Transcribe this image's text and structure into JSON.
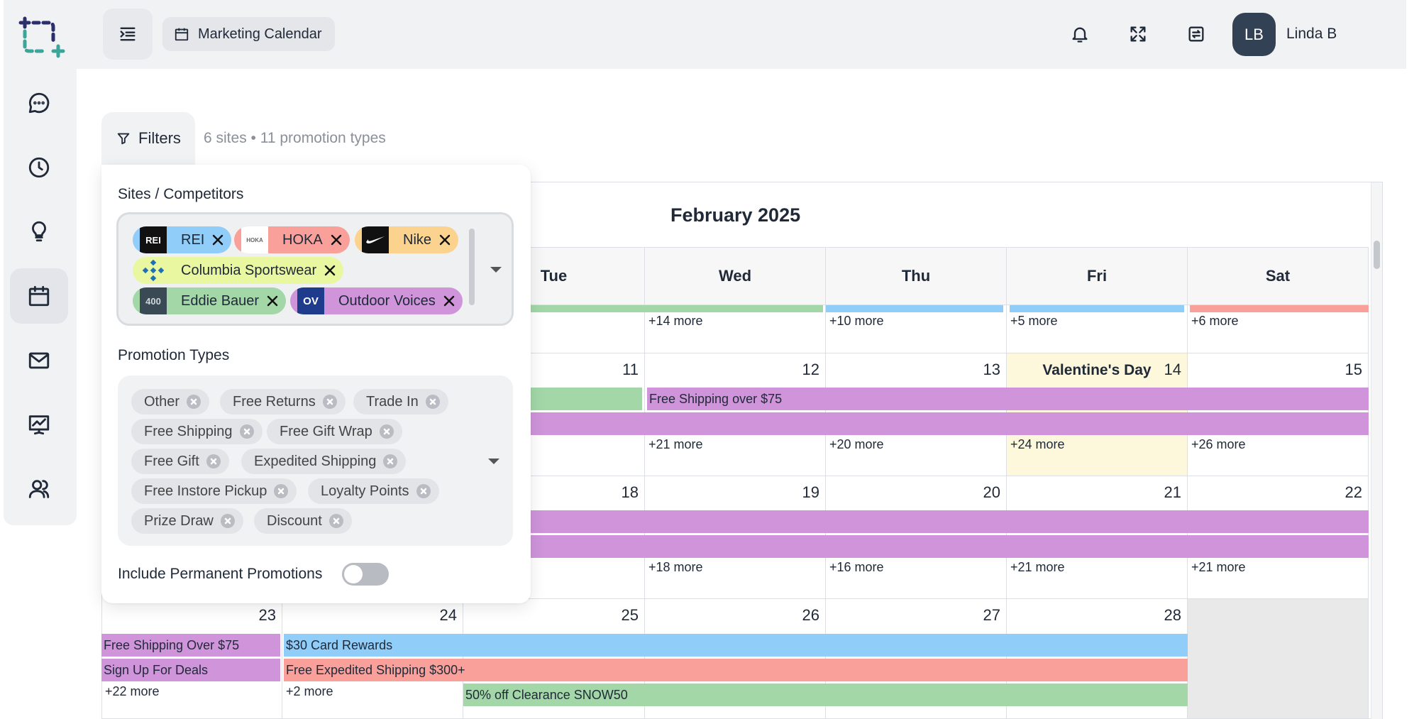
{
  "app": {
    "title": "Marketing Calendar"
  },
  "user": {
    "initials": "LB",
    "name": "Linda B"
  },
  "sidebar": {
    "icons": [
      "chat-icon",
      "clock-icon",
      "lightbulb-icon",
      "calendar-icon",
      "mail-icon",
      "presentation-chart-icon",
      "users-icon"
    ],
    "active": "calendar-icon"
  },
  "topbar": {
    "icons": [
      "bell-icon",
      "fullscreen-icon",
      "refresh-calendar-icon"
    ]
  },
  "filters": {
    "button_label": "Filters",
    "summary": "6 sites • 11 promotion types",
    "sites_label": "Sites / Competitors",
    "sites": [
      {
        "name": "REI",
        "color": "#90cdf9"
      },
      {
        "name": "HOKA",
        "color": "#f9a09b"
      },
      {
        "name": "Nike",
        "color": "#fbd28e"
      },
      {
        "name": "Columbia Sportswear",
        "color": "#e9f7a0"
      },
      {
        "name": "Eddie Bauer",
        "color": "#a3d7a8"
      },
      {
        "name": "Outdoor Voices",
        "color": "#cf94da"
      }
    ],
    "logos": {
      "rei": "REI",
      "hoka": "HOKA",
      "eddie": "400",
      "ov": "OV"
    },
    "promo_label": "Promotion Types",
    "promo_types": [
      "Other",
      "Free Returns",
      "Trade In",
      "Free Shipping",
      "Free Gift Wrap",
      "Free Gift",
      "Expedited Shipping",
      "Free Instore Pickup",
      "Loyalty Points",
      "Prize Draw",
      "Discount"
    ],
    "permanent_label": "Include Permanent Promotions",
    "permanent_on": false
  },
  "calendar": {
    "title": "February 2025",
    "weekdays": [
      "Tue",
      "Wed",
      "Thu",
      "Fri",
      "Sat"
    ],
    "week1": {
      "more": [
        "+14 more",
        "+10 more",
        "+5 more",
        "+6 more"
      ]
    },
    "week2": {
      "days": [
        "11",
        "12",
        "13",
        "14",
        "15"
      ],
      "holiday": "Valentine's Day",
      "bar_label": "Free Shipping over $75",
      "more": [
        "+21 more",
        "+20 more",
        "+24 more",
        "+26 more"
      ]
    },
    "week3": {
      "days": [
        "18",
        "19",
        "20",
        "21",
        "22"
      ],
      "more": [
        "+18 more",
        "+16 more",
        "+21 more",
        "+21 more"
      ]
    },
    "week4": {
      "days": [
        "23",
        "24",
        "25",
        "26",
        "27",
        "28"
      ],
      "bars": [
        "Free Shipping Over $75",
        "Sign Up For Deals",
        "$30 Card Rewards",
        "Free Expedited Shipping $300+",
        "50% off Clearance SNOW50"
      ],
      "more": [
        "+22 more",
        "+2 more"
      ]
    }
  }
}
